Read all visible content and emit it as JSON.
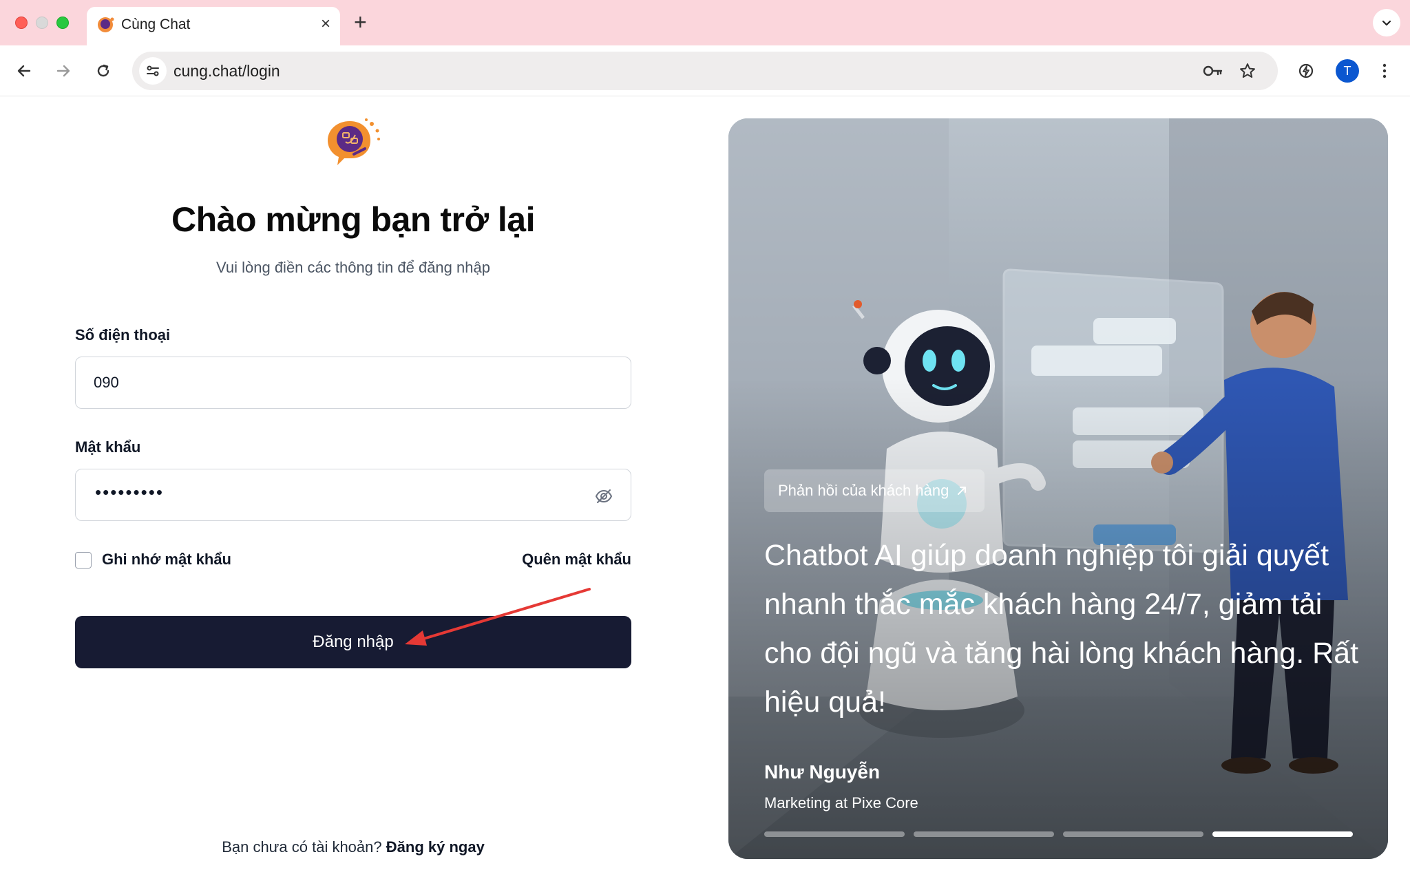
{
  "browser": {
    "tab_title": "Cùng Chat",
    "tab_close": "×",
    "new_tab": "+",
    "url": "cung.chat/login",
    "profile_initial": "T"
  },
  "login": {
    "title": "Chào mừng bạn trở lại",
    "subtitle": "Vui lòng điền các thông tin để đăng nhập",
    "phone_label": "Số điện thoại",
    "phone_value": "090",
    "password_label": "Mật khẩu",
    "password_mask": "•••••••••",
    "remember_label": "Ghi nhớ mật khẩu",
    "forgot_label": "Quên mật khẩu",
    "submit_label": "Đăng nhập",
    "no_account_text": "Bạn chưa có tài khoản?",
    "signup_label": "Đăng ký ngay"
  },
  "testimonial": {
    "badge": "Phản hồi của khách hàng",
    "quote": "Chatbot AI giúp doanh nghiệp tôi giải quyết nhanh thắc mắc khách hàng 24/7, giảm tải cho đội ngũ và tăng hài lòng khách hàng. Rất hiệu quả!",
    "author": "Như Nguyễn",
    "role": "Marketing at Pixe Core",
    "slides_total": 4,
    "active_slide": 4
  },
  "colors": {
    "tab_bar": "#fbd6dc",
    "primary_button": "#171b33",
    "annotation_arrow": "#e53935",
    "profile": "#0b57d0"
  },
  "icons": [
    "back-arrow-icon",
    "forward-arrow-icon",
    "reload-icon",
    "site-info-icon",
    "password-key-icon",
    "bookmark-star-icon",
    "extension-icon",
    "more-vert-icon",
    "eye-off-icon",
    "external-link-icon"
  ]
}
